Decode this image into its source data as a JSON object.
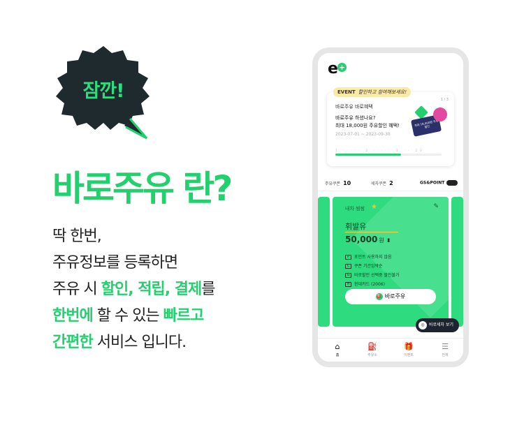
{
  "badge": {
    "text": "잠깐!"
  },
  "headline": "바로주유 란?",
  "body": {
    "line1": "딱 한번,",
    "line2": "주유정보를 등록하면",
    "line3_pre": "주유 시 ",
    "line3_hl": "할인, 적립, 결제",
    "line3_post": "를",
    "line4_hl1": "한번에",
    "line4_mid": " 할 수 있는 ",
    "line4_hl2": "빠르고",
    "line5_hl": "간편한",
    "line5_post": " 서비스 입니다."
  },
  "app": {
    "logo": "e",
    "logo_plus": "+",
    "event": {
      "tab_label": "EVENT",
      "tab_cheer": "할인하고 참여해보세요!",
      "page": "1 / 3",
      "title": "바로주유 바로혜택",
      "desc_line1": "바로주유 하셨나요?",
      "desc_line2": "최대 18,000원 주유할인 혜택!",
      "date": "2023-07-01 ~ 2023-09-30",
      "ticks": "1 ····· 2 ····· 3 ·· 20",
      "art_card_text": "최대 18,000원 주유 할인",
      "progress": 0.62
    },
    "coupons": {
      "fuel_label": "주유쿠폰",
      "fuel_count": "10",
      "wash_label": "세차쿠폰",
      "wash_count": "2",
      "gs_label": "GS&POINT"
    },
    "card": {
      "label": "내차 씽씽",
      "fuel_type": "휘발유",
      "amount": "50,000",
      "currency": "원",
      "items": [
        {
          "icon": "P",
          "text": "포인트 사용하지 않음"
        },
        {
          "icon": "C",
          "text": "쿠폰 기간임박순"
        },
        {
          "icon": "G",
          "text": "바로할인 선택중 할인불가"
        },
        {
          "icon": "H",
          "text": "현대카드 (2006)"
        }
      ],
      "button": "바로주유"
    },
    "fab": "바로세차 보기",
    "nav": [
      {
        "icon": "⌂",
        "label": "홈"
      },
      {
        "icon": "⛽",
        "label": "주유소"
      },
      {
        "icon": "🎁",
        "label": "이벤트"
      },
      {
        "icon": "☰",
        "label": "전체"
      }
    ]
  },
  "colors": {
    "brand_green": "#22d06e",
    "badge_bg": "#1e2a2e",
    "card_green": "#2fdb7f"
  }
}
